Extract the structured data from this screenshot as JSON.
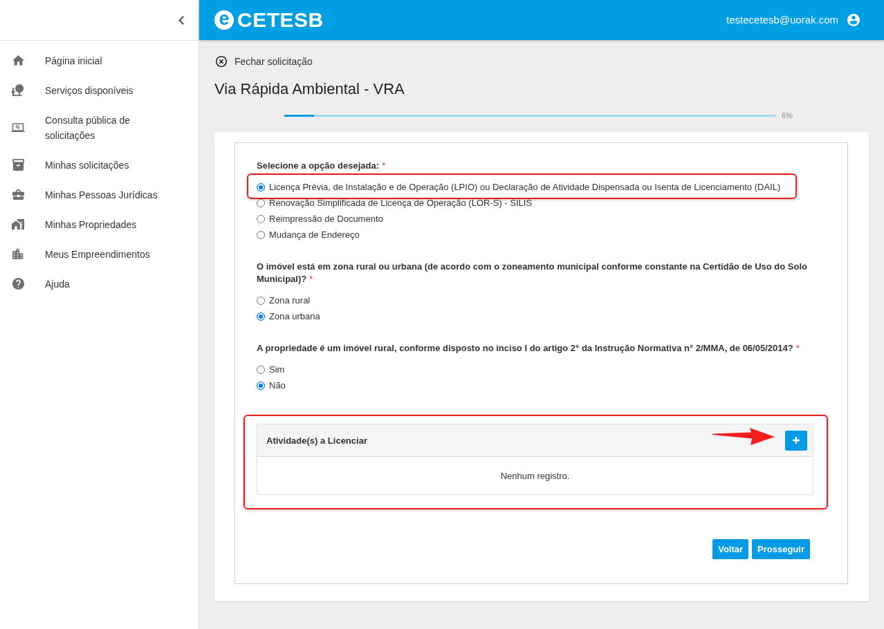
{
  "sidebar": {
    "items": [
      {
        "label": "Página inicial"
      },
      {
        "label": "Serviços disponíveis"
      },
      {
        "label": "Consulta pública de solicitações"
      },
      {
        "label": "Minhas solicitações"
      },
      {
        "label": "Minhas Pessoas Jurídicas"
      },
      {
        "label": "Minhas Propriedades"
      },
      {
        "label": "Meus Empreendimentos"
      },
      {
        "label": "Ajuda"
      }
    ]
  },
  "header": {
    "logo_mark": "e",
    "logo_text": "CETESB",
    "user_email": "testecetesb@uorak.com"
  },
  "close_link": {
    "label": "Fechar solicitação"
  },
  "page_title": "Via Rápida Ambiental - VRA",
  "progress": {
    "level": 0.06,
    "reading": "6%"
  },
  "form": {
    "questions": [
      {
        "label": "Selecione a opção desejada:",
        "required_mark": "*",
        "options": [
          {
            "label": "Licença Prévia, de Instalação e de Operação (LPIO) ou Declaração de Atividade Dispensada ou Isenta de Licenciamento (DAIL)",
            "selected": true,
            "highlighted": true
          },
          {
            "label": "Renovação Simplificada de Licença de Operação (LOR-S) - SILIS",
            "selected": false,
            "highlighted": false
          },
          {
            "label": "Reimpressão de Documento",
            "selected": false,
            "highlighted": false
          },
          {
            "label": "Mudança de Endereço",
            "selected": false,
            "highlighted": false
          }
        ]
      },
      {
        "label": "O imóvel está em zona rural ou urbana (de acordo com o zoneamento municipal conforme constante na Certidão de Uso do Solo Municipal)?",
        "required_mark": "*",
        "options": [
          {
            "label": "Zona rural",
            "selected": false,
            "highlighted": false
          },
          {
            "label": "Zona urbana",
            "selected": true,
            "highlighted": false
          }
        ]
      },
      {
        "label": "A propriedade é um imóvel rural, conforme disposto no inciso I do artigo 2° da Instrução Normativa n° 2/MMA, de 06/05/2014?",
        "required_mark": "*",
        "options": [
          {
            "label": "Sim",
            "selected": false,
            "highlighted": false
          },
          {
            "label": "Não",
            "selected": true,
            "highlighted": false
          }
        ]
      }
    ],
    "activities_panel": {
      "title": "Atividade(s) a Licenciar",
      "empty_message": "Nenhum registro.",
      "highlighted": true,
      "add_button": {
        "pointed_at": true
      }
    },
    "buttons": [
      {
        "label": "Voltar"
      },
      {
        "label": "Prosseguir"
      }
    ]
  }
}
